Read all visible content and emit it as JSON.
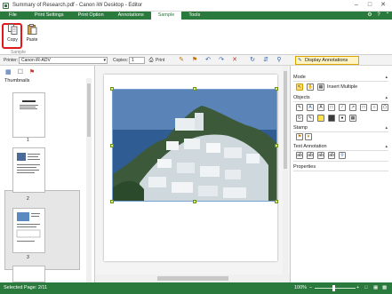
{
  "window": {
    "title": "Summary of Research.pdf - Canon iW Desktop - Editor",
    "minimize_icon": "minimize-icon",
    "maximize_icon": "maximize-icon",
    "close_icon": "close-icon"
  },
  "menu": {
    "items": [
      "File",
      "Print Settings",
      "Print Option",
      "Annotations",
      "Sample",
      "Tools"
    ],
    "active": "Sample",
    "accent": "#2a7a3d"
  },
  "ribbon": {
    "copy_label": "Copy",
    "paste_label": "Paste",
    "group_label": "Sample",
    "highlight_color": "#e0181b"
  },
  "toolbar": {
    "printer_label": "Printer:",
    "printer_value": "Canon iR-ADV",
    "copies_label": "Copies:",
    "copies_value": "1",
    "print_label": "Print",
    "display_annotations_label": "Display Annotations"
  },
  "thumbnails": {
    "header": "Thumbnails",
    "pages": [
      "1",
      "2",
      "3"
    ],
    "selected": "2"
  },
  "right_panel": {
    "mode_label": "Mode",
    "insert_multiple_label": "Insert Multiple",
    "objects_label": "Objects",
    "stamp_label": "Stamp",
    "text_annotation_label": "Text Annotation",
    "properties_label": "Properties"
  },
  "status": {
    "selected_page": "Selected Page: 2/11",
    "zoom": "100%"
  }
}
